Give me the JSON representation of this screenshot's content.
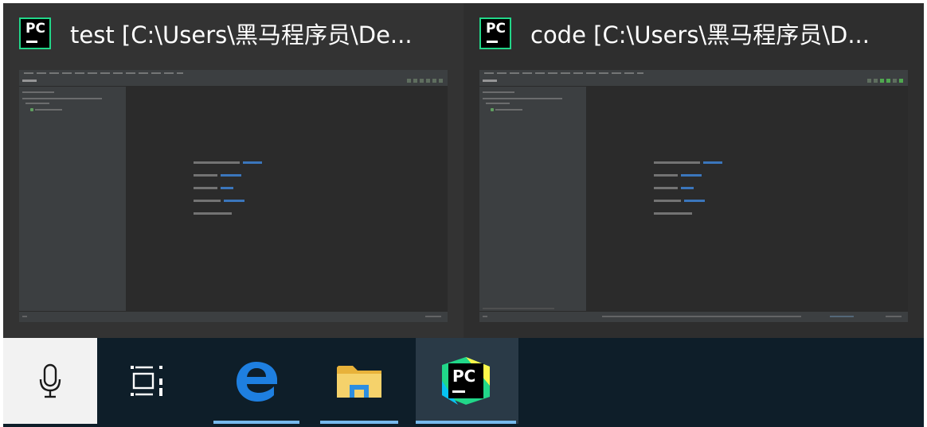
{
  "windows": [
    {
      "title": "test [C:\\Users\\黑马程序员\\De...",
      "app_icon": "pycharm-icon",
      "icon_text": "PC"
    },
    {
      "title": "code [C:\\Users\\黑马程序员\\D...",
      "app_icon": "pycharm-icon",
      "icon_text": "PC"
    }
  ],
  "taskbar": {
    "items": [
      {
        "name": "microphone",
        "icon": "microphone-icon"
      },
      {
        "name": "task-view",
        "icon": "task-view-icon"
      },
      {
        "name": "edge",
        "icon": "edge-icon",
        "running": true
      },
      {
        "name": "file-explorer",
        "icon": "folder-icon",
        "running": true
      },
      {
        "name": "pycharm",
        "icon": "pycharm-icon",
        "icon_text": "PC",
        "running": true,
        "active": true
      }
    ]
  },
  "colors": {
    "taskbar_bg": "#0e1e29",
    "popup_bg": "#333333",
    "pycharm_green": "#21d789",
    "indicator_blue": "#76b9ed",
    "ide_bg": "#2b2b2b",
    "ide_panel": "#3c3f41"
  }
}
